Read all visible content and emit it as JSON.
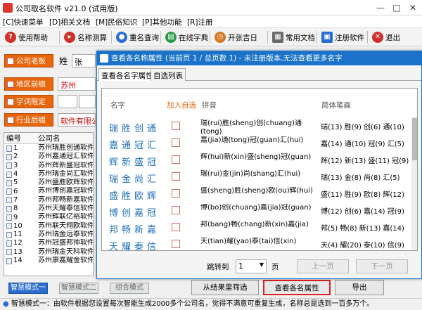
{
  "window": {
    "title": "公司取名软件 v21.0 (试用版)"
  },
  "menu": [
    "[C]快速菜单",
    "[D]相关文档",
    "[M]民俗知识",
    "[P]其他功能",
    "[R]注册"
  ],
  "toolbar": [
    {
      "label": "使用帮助",
      "icon": "help-icon",
      "color": "#d0302a"
    },
    {
      "label": "名称测算",
      "icon": "calc-icon",
      "color": "#d0302a"
    },
    {
      "label": "重名查询",
      "icon": "person-icon",
      "color": "#2a6dd0"
    },
    {
      "label": "在线字典",
      "icon": "book-icon",
      "color": "#2a9a4a"
    },
    {
      "label": "开张吉日",
      "icon": "calendar-icon",
      "color": "#d07a20"
    },
    {
      "label": "常用文档",
      "icon": "document-icon",
      "color": "#6a6a6a"
    },
    {
      "label": "注册软件",
      "icon": "register-icon",
      "color": "#2a6dd0"
    },
    {
      "label": "退出",
      "icon": "exit-icon",
      "color": "#d0302a"
    }
  ],
  "form": {
    "boss_btn": "公司老板",
    "surname_label": "姓",
    "surname_value": "张",
    "region_btn": "地区前缀",
    "region_value": "苏州",
    "prefix_btn": "字词限定",
    "industry_btn": "行业后缀",
    "industry_value": "软件有限公"
  },
  "list": {
    "headers": [
      "编号",
      "公司名"
    ],
    "rows": [
      {
        "n": "1",
        "name": "苏州瑞胜创通软件"
      },
      {
        "n": "2",
        "name": "苏州嘉通冠汇软件"
      },
      {
        "n": "3",
        "name": "苏州辉新盛冠软件"
      },
      {
        "n": "4",
        "name": "苏州瑞金尚汇软件"
      },
      {
        "n": "5",
        "name": "苏州盛胜欧辉软件"
      },
      {
        "n": "6",
        "name": "苏州博创嘉冠软件"
      },
      {
        "n": "7",
        "name": "苏州邦畅新嘉软件"
      },
      {
        "n": "8",
        "name": "苏州天耀泰信软件"
      },
      {
        "n": "9",
        "name": "苏州辉联亿裕软件"
      },
      {
        "n": "10",
        "name": "苏州联天翔欧软件"
      },
      {
        "n": "11",
        "name": "苏州瑞金远泰软件"
      },
      {
        "n": "12",
        "name": "苏州冠盛邦帅软件"
      },
      {
        "n": "13",
        "name": "苏州瑞金天科软件"
      },
      {
        "n": "14",
        "name": "苏州康嘉耀金软件"
      }
    ]
  },
  "modes": [
    "智慧模式一",
    "智慧模式二",
    "组合模式"
  ],
  "buttons": {
    "filter": "从结果里筛选",
    "attrs": "查看各名属性",
    "export": "导出"
  },
  "status": "智慧模式一：由软件根据您设置每次智能生成2000多个公司名，觉得不满意可重复生成，名称总是选到一百多万个。",
  "dialog": {
    "title": "查看各名称属性 (当前页 1 / 总页数 1) - 未注册版本,无法查看更多名字",
    "tabs": [
      "查看各名字属性",
      "自选列表"
    ],
    "col_name": "名字",
    "col_add": "加入自选",
    "col_pinyin": "拼音",
    "col_strokes": "简体笔画",
    "items": [
      {
        "chars": "瑞胜创通",
        "pinyin": "瑞(rui)胜(sheng)创(chuang)通(tong)",
        "strokes": "瑞(13) 胜(9) 创(6) 通(10)"
      },
      {
        "chars": "嘉通冠汇",
        "pinyin": "嘉(jia)通(tong)冠(guan)汇(hui)",
        "strokes": "嘉(14) 通(10) 冠(9) 汇(5)"
      },
      {
        "chars": "辉新盛冠",
        "pinyin": "辉(hui)新(xin)盛(sheng)冠(guan)",
        "strokes": "辉(12) 新(13) 盛(11) 冠(9)"
      },
      {
        "chars": "瑞金尚汇",
        "pinyin": "瑞(rui)金(jin)尚(shang)汇(hui)",
        "strokes": "瑞(13) 金(8) 尚(8) 汇(5)"
      },
      {
        "chars": "盛胜欧辉",
        "pinyin": "盛(sheng)胜(sheng)欧(ou)辉(hui)",
        "strokes": "盛(11) 胜(9) 欧(8) 辉(12)"
      },
      {
        "chars": "博创嘉冠",
        "pinyin": "博(bo)创(chuang)嘉(jia)冠(guan)",
        "strokes": "博(12) 创(6) 嘉(14) 冠(9)"
      },
      {
        "chars": "邦畅新嘉",
        "pinyin": "邦(bang)畅(chang)新(xin)嘉(jia)",
        "strokes": "邦(5) 畅(8) 新(13) 嘉(14)"
      },
      {
        "chars": "天耀泰信",
        "pinyin": "天(tian)耀(yao)泰(tai)信(xin)",
        "strokes": "天(4) 耀(20) 泰(10) 信(9)"
      }
    ],
    "jump_label": "跳转到",
    "page_value": "1",
    "page_unit": "页",
    "prev": "上一页",
    "next": "下一页"
  }
}
